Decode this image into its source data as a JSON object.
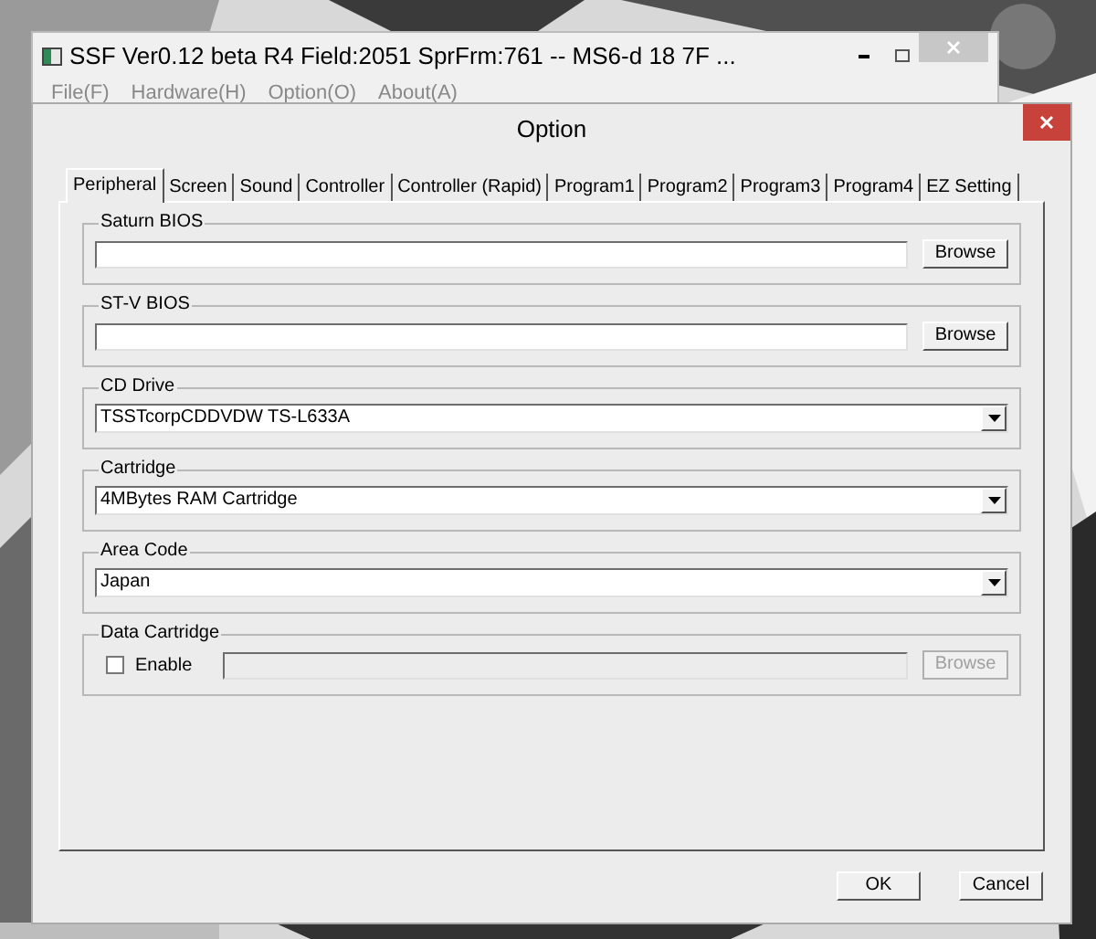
{
  "main_window": {
    "title": "SSF Ver0.12 beta R4  Field:2051  SprFrm:761  -- MS6-d  18 7F ...",
    "menu": [
      "File(F)",
      "Hardware(H)",
      "Option(O)",
      "About(A)"
    ]
  },
  "dialog": {
    "title": "Option",
    "tabs": [
      {
        "label": "Peripheral",
        "selected": true
      },
      {
        "label": "Screen",
        "selected": false
      },
      {
        "label": "Sound",
        "selected": false
      },
      {
        "label": "Controller",
        "selected": false
      },
      {
        "label": "Controller (Rapid)",
        "selected": false
      },
      {
        "label": "Program1",
        "selected": false
      },
      {
        "label": "Program2",
        "selected": false
      },
      {
        "label": "Program3",
        "selected": false
      },
      {
        "label": "Program4",
        "selected": false
      },
      {
        "label": "EZ Setting",
        "selected": false
      }
    ],
    "groups": [
      {
        "kind": "file",
        "label": "Saturn BIOS",
        "button": "Browse"
      },
      {
        "kind": "file",
        "label": "ST-V BIOS",
        "button": "Browse"
      },
      {
        "kind": "select",
        "label": "CD Drive",
        "value": "TSSTcorpCDDVDW TS-L633A"
      },
      {
        "kind": "select",
        "label": "Cartridge",
        "value": "4MBytes RAM Cartridge"
      },
      {
        "kind": "select",
        "label": "Area Code",
        "value": "Japan"
      },
      {
        "kind": "checkbox",
        "label": "Data Cartridge",
        "checkbox_label": "Enable",
        "checked": false,
        "button": "Browse",
        "disabled": true
      }
    ],
    "buttons": [
      "OK",
      "Cancel"
    ]
  }
}
